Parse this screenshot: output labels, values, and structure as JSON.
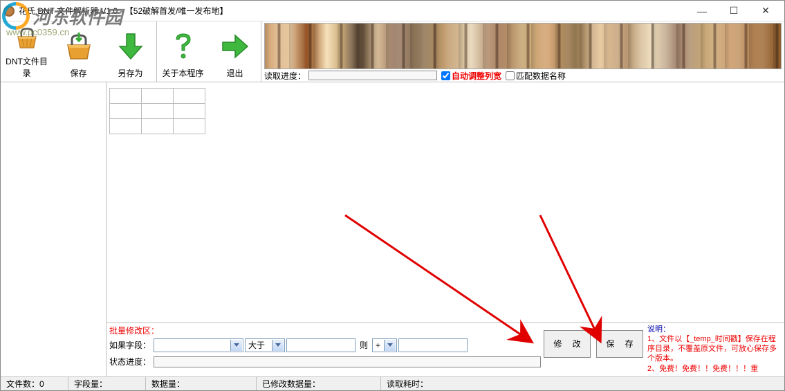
{
  "titlebar": {
    "text": "花氏 DNT 文件解析器 V1.0 - 【52破解首发/唯一发布地】"
  },
  "watermark": {
    "brand": "河东软件园",
    "url": "www.pc0359.cn"
  },
  "toolbar": {
    "btn_dir": "DNT文件目录",
    "btn_save": "保存",
    "btn_saveas": "另存为",
    "btn_about": "关于本程序",
    "btn_exit": "退出"
  },
  "banner": {
    "progress_label": "读取进度：",
    "cb_auto": "自动调整列宽",
    "cb_match": "匹配数据名称"
  },
  "batch": {
    "title": "批量修改区：",
    "if_field": "如果字段：",
    "op": "大于",
    "then": "则",
    "plus": "+",
    "status_label": "状态进度：",
    "btn_modify": "修 改",
    "btn_save": "保 存"
  },
  "help": {
    "title": "说明：",
    "line1": "1、文件以【_temp_时间戳】保存在程序目录，不覆盖原文件，可放心保存多个版本。",
    "line2": "2、免费！免费！！免费！！！重"
  },
  "status": {
    "files": "文件数：0",
    "fields": "字段量：",
    "data": "数据量：",
    "modified": "已修改数据量：",
    "time": "读取耗时："
  },
  "win": {
    "min": "—",
    "max": "☐",
    "close": "✕"
  }
}
